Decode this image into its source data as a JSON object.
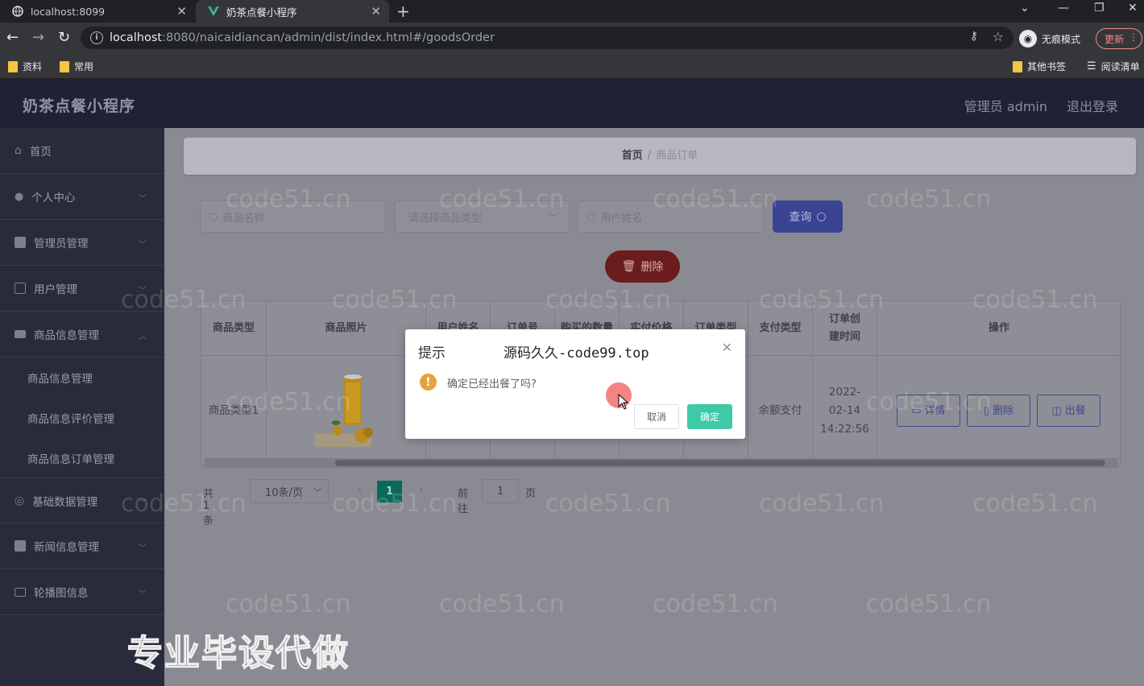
{
  "browser": {
    "tabs": [
      {
        "title": "localhost:8099"
      },
      {
        "title": "奶茶点餐小程序"
      }
    ],
    "url_host": "localhost",
    "url_rest": ":8080/naicaidiancan/admin/dist/index.html#/goodsOrder",
    "incognito_label": "无痕模式",
    "update_label": "更新",
    "bookmarks": [
      "资料",
      "常用"
    ],
    "bookmarks_right": [
      "其他书签",
      "阅读清单"
    ]
  },
  "app": {
    "brand": "奶茶点餐小程序",
    "user_label": "管理员 admin",
    "logout_label": "退出登录"
  },
  "sidebar": {
    "items": [
      {
        "label": "首页"
      },
      {
        "label": "个人中心"
      },
      {
        "label": "管理员管理"
      },
      {
        "label": "用户管理"
      },
      {
        "label": "商品信息管理"
      },
      {
        "label": "基础数据管理"
      },
      {
        "label": "新闻信息管理"
      },
      {
        "label": "轮播图信息"
      }
    ],
    "submenu": [
      {
        "label": "商品信息管理"
      },
      {
        "label": "商品信息评价管理"
      },
      {
        "label": "商品信息订单管理"
      }
    ]
  },
  "breadcrumb": {
    "home": "首页",
    "separator": "/",
    "current": "商品订单"
  },
  "search": {
    "goods_name_placeholder": "商品名称",
    "goods_type_placeholder": "请选择商品类型",
    "user_name_placeholder": "用户姓名",
    "query_label": "查询"
  },
  "actions": {
    "delete_label": "删除"
  },
  "table": {
    "headers": [
      "商品类型",
      "商品照片",
      "用户姓名",
      "订单号",
      "购买的数量",
      "实付价格",
      "订单类型",
      "支付类型",
      "订单创建时间",
      "操作"
    ],
    "row": {
      "goods_type": "商品类型1",
      "pay_type": "余额支付",
      "created": "2022-02-14 14:22:56",
      "ops": [
        "详情",
        "删除",
        "出餐"
      ]
    }
  },
  "pagination": {
    "total": "共 1 条",
    "page_size": "10条/页",
    "current_page": "1",
    "goto_label": "前往",
    "goto_value": "1",
    "page_unit": "页"
  },
  "dialog": {
    "title": "提示",
    "overlay_text": "源码久久-code99.top",
    "message": "确定已经出餐了吗?",
    "cancel": "取消",
    "confirm": "确定"
  },
  "watermark": "code51.cn",
  "promo": "专业毕设代做",
  "colors": {
    "accent": "#3ec9a7",
    "warning": "#e6a23c",
    "header_bg": "#1f2235",
    "sidebar_bg": "#282b3a"
  }
}
